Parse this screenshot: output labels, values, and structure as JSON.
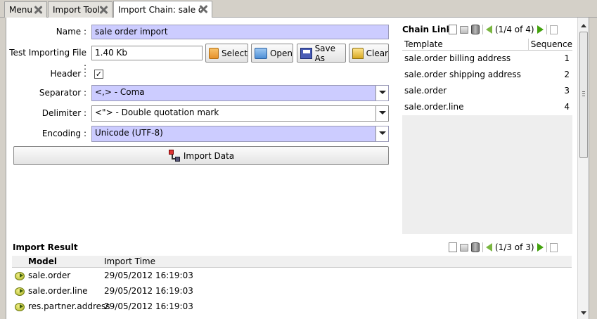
{
  "tabs": [
    {
      "label": "Menu"
    },
    {
      "label": "Import Tool"
    },
    {
      "label": "Import Chain: sale o"
    }
  ],
  "form": {
    "name_label": "Name :",
    "name_value": "sale order import",
    "file_label": "Test Importing File :",
    "file_value": "1.40 Kb",
    "header_label": "Header :",
    "header_checked": "✓",
    "separator_label": "Separator :",
    "separator_value": "<,> - Coma",
    "delimiter_label": "Delimiter :",
    "delimiter_value": "<\"> - Double quotation mark",
    "encoding_label": "Encoding :",
    "encoding_value": "Unicode (UTF-8)"
  },
  "buttons": {
    "select": "Select",
    "open": "Open",
    "save_as": "Save As",
    "clear": "Clear",
    "import_data": "Import Data"
  },
  "chain_link": {
    "title": "Chain Link",
    "pager": "(1/4 of 4)",
    "columns": [
      "Template",
      "Sequence"
    ],
    "rows": [
      {
        "template": "sale.order billing address",
        "sequence": "1"
      },
      {
        "template": "sale.order shipping address",
        "sequence": "2"
      },
      {
        "template": "sale.order",
        "sequence": "3"
      },
      {
        "template": "sale.order.line",
        "sequence": "4"
      }
    ]
  },
  "import_result": {
    "title": "Import Result",
    "pager": "(1/3 of 3)",
    "columns": [
      "Model",
      "Import Time"
    ],
    "rows": [
      {
        "model": "sale.order",
        "time": "29/05/2012 16:19:03"
      },
      {
        "model": "sale.order.line",
        "time": "29/05/2012 16:19:03"
      },
      {
        "model": "res.partner.address",
        "time": "29/05/2012 16:19:03"
      }
    ]
  },
  "colors": {
    "required_field": "#ccccff",
    "window_bg": "#d4d0c8"
  },
  "icons": [
    "close-icon",
    "folder-icon",
    "save-icon",
    "clear-icon",
    "import-icon",
    "new-record-icon",
    "open-folder-icon",
    "delete-icon",
    "previous-icon",
    "next-icon",
    "form-view-icon",
    "arrow-right-icon"
  ]
}
